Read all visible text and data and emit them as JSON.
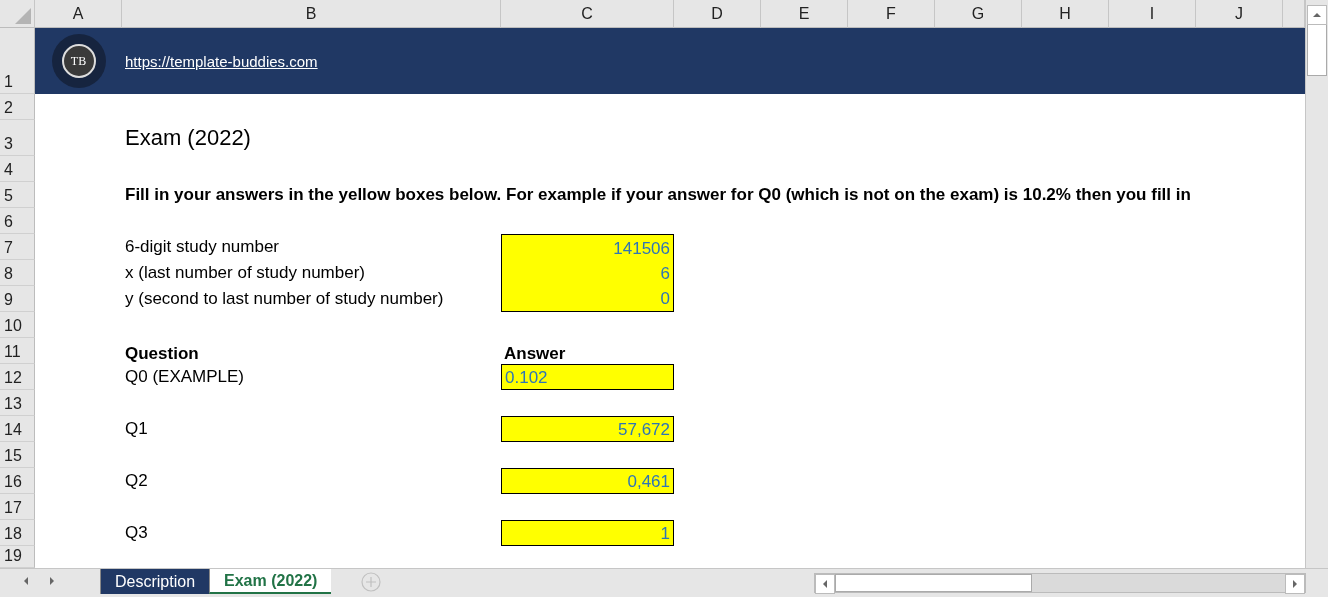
{
  "sheet": {
    "columns": [
      "A",
      "B",
      "C",
      "D",
      "E",
      "F",
      "G",
      "H",
      "I",
      "J"
    ],
    "rows": [
      "1",
      "2",
      "3",
      "4",
      "5",
      "6",
      "7",
      "8",
      "9",
      "10",
      "11",
      "12",
      "13",
      "14",
      "15",
      "16",
      "17",
      "18",
      "19"
    ]
  },
  "banner": {
    "logo_text": "TB",
    "link": "https://template-buddies.com"
  },
  "title": "Exam (2022)",
  "instruction": "Fill in your answers in the yellow boxes below. For example if your answer for Q0 (which is not on the exam) is 10.2% then you fill in",
  "study_fields": [
    {
      "label": "6-digit study number",
      "value": "141506"
    },
    {
      "label": "x (last number of study number)",
      "value": "6"
    },
    {
      "label": "y (second to last number of study number)",
      "value": "0"
    }
  ],
  "answers_header": {
    "question": "Question",
    "answer": "Answer"
  },
  "questions": [
    {
      "label": "Q0 (EXAMPLE)",
      "answer": "0.102",
      "kind": "text"
    },
    {
      "label": "Q1",
      "answer": "57,672",
      "kind": "number"
    },
    {
      "label": "Q2",
      "answer": "0,461",
      "kind": "number"
    },
    {
      "label": "Q3",
      "answer": "1",
      "kind": "number"
    }
  ],
  "sheet_tabs": [
    {
      "label": "Description",
      "selected": false
    },
    {
      "label": "Exam (2022)",
      "selected": true
    }
  ]
}
